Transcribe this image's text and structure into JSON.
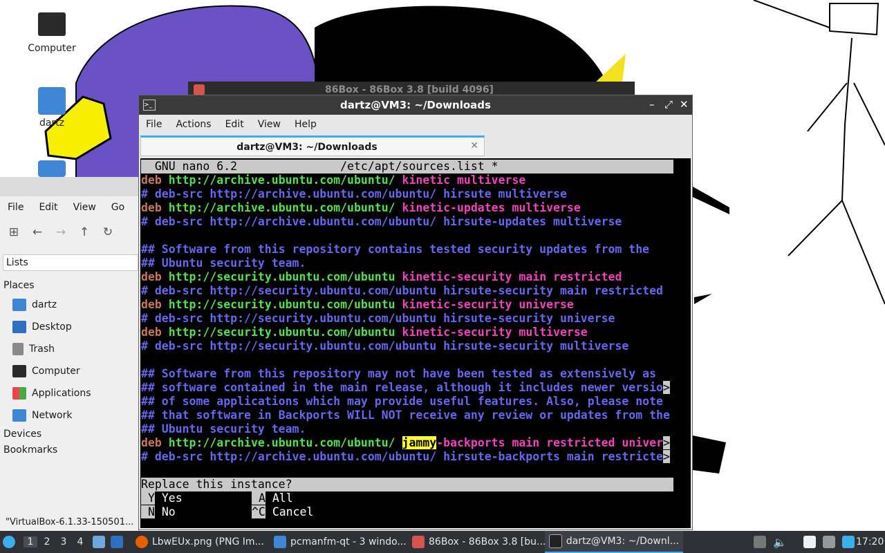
{
  "desktop": {
    "icons": [
      {
        "label": "Computer"
      },
      {
        "label": "dartz"
      }
    ]
  },
  "file_manager": {
    "menu": [
      "File",
      "Edit",
      "View",
      "Go"
    ],
    "location": "Lists",
    "places_header": "Places",
    "places": [
      "dartz",
      "Desktop",
      "Trash",
      "Computer",
      "Applications",
      "Network"
    ],
    "devices": "Devices",
    "bookmarks": "Bookmarks",
    "status": "\"VirtualBox-6.1.33-150501..."
  },
  "bg_window": {
    "title": "86Box - 86Box 3.8 [build 4096]"
  },
  "terminal": {
    "title": "dartz@VM3: ~/Downloads",
    "menu": [
      "File",
      "Actions",
      "Edit",
      "View",
      "Help"
    ],
    "tab_label": "dartz@VM3: ~/Downloads",
    "nano": {
      "header": "  GNU nano 6.2               /etc/apt/sources.list *",
      "prompt": "Replace this instance?",
      "options": [
        {
          "key": "Y",
          "label": "Yes"
        },
        {
          "key": "A",
          "label": "All"
        },
        {
          "key": "N",
          "label": "No"
        },
        {
          "key": "^C",
          "label": "Cancel"
        }
      ]
    }
  },
  "taskbar": {
    "workspaces": [
      "1",
      "2",
      "3",
      "4"
    ],
    "tasks": [
      "LbwEUx.png (PNG Im...",
      "pcmanfm-qt - 3 windo...",
      "86Box - 86Box 3.8 [bu...",
      "dartz@VM3: ~/Downl..."
    ],
    "clock": "17:20"
  },
  "colors": {
    "terminal_bg": "#000000",
    "comment": "#6666ee",
    "url": "#52e052",
    "keyword_deb": "#c9775a",
    "suite": "#ee44bb",
    "match_highlight": "#ffff33",
    "accent": "#3daee9"
  }
}
